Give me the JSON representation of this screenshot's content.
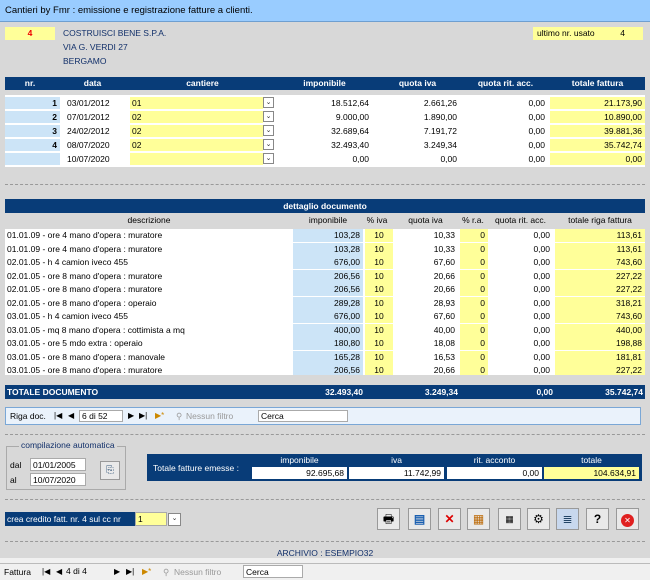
{
  "window": {
    "title": "Cantieri by Fmr : emissione e registrazione fatture a clienti."
  },
  "client": {
    "code": "4",
    "name": "COSTRUISCI BENE S.P.A.",
    "address": "VIA G. VERDI 27",
    "city": "BERGAMO"
  },
  "last_number": {
    "label": "ultimo nr. usato",
    "value": "4"
  },
  "invoices": {
    "headers": {
      "nr": "nr.",
      "data": "data",
      "cantiere": "cantiere",
      "imponibile": "imponibile",
      "iva": "quota iva",
      "rit": "quota rit. acc.",
      "totale": "totale fattura"
    },
    "rows": [
      {
        "nr": "1",
        "data": "03/01/2012",
        "cantiere": "01",
        "imponibile": "18.512,64",
        "iva": "2.661,26",
        "rit": "0,00",
        "totale": "21.173,90"
      },
      {
        "nr": "2",
        "data": "07/01/2012",
        "cantiere": "02",
        "imponibile": "9.000,00",
        "iva": "1.890,00",
        "rit": "0,00",
        "totale": "10.890,00"
      },
      {
        "nr": "3",
        "data": "24/02/2012",
        "cantiere": "02",
        "imponibile": "32.689,64",
        "iva": "7.191,72",
        "rit": "0,00",
        "totale": "39.881,36"
      },
      {
        "nr": "4",
        "data": "08/07/2020",
        "cantiere": "02",
        "imponibile": "32.493,40",
        "iva": "3.249,34",
        "rit": "0,00",
        "totale": "35.742,74"
      },
      {
        "nr": "",
        "data": "10/07/2020",
        "cantiere": "",
        "imponibile": "0,00",
        "iva": "0,00",
        "rit": "0,00",
        "totale": "0,00"
      }
    ]
  },
  "detail": {
    "title": "dettaglio documento",
    "headers": {
      "descr": "descrizione",
      "imponibile": "imponibile",
      "piva": "% iva",
      "iva": "quota iva",
      "pra": "% r.a.",
      "rit": "quota rit. acc.",
      "totale": "totale riga fattura"
    },
    "rows": [
      {
        "descr": "01.01.09 - ore 4 mano d'opera : muratore",
        "imponibile": "103,28",
        "piva": "10",
        "iva": "10,33",
        "pra": "0",
        "rit": "0,00",
        "totale": "113,61"
      },
      {
        "descr": "01.01.09 - ore 4 mano d'opera : muratore",
        "imponibile": "103,28",
        "piva": "10",
        "iva": "10,33",
        "pra": "0",
        "rit": "0,00",
        "totale": "113,61"
      },
      {
        "descr": "02.01.05 - h 4 camion iveco 455",
        "imponibile": "676,00",
        "piva": "10",
        "iva": "67,60",
        "pra": "0",
        "rit": "0,00",
        "totale": "743,60"
      },
      {
        "descr": "02.01.05 - ore 8 mano d'opera : muratore",
        "imponibile": "206,56",
        "piva": "10",
        "iva": "20,66",
        "pra": "0",
        "rit": "0,00",
        "totale": "227,22"
      },
      {
        "descr": "02.01.05 - ore 8 mano d'opera : muratore",
        "imponibile": "206,56",
        "piva": "10",
        "iva": "20,66",
        "pra": "0",
        "rit": "0,00",
        "totale": "227,22"
      },
      {
        "descr": "02.01.05 - ore 8 mano d'opera : operaio",
        "imponibile": "289,28",
        "piva": "10",
        "iva": "28,93",
        "pra": "0",
        "rit": "0,00",
        "totale": "318,21"
      },
      {
        "descr": "03.01.05 - h 4 camion iveco 455",
        "imponibile": "676,00",
        "piva": "10",
        "iva": "67,60",
        "pra": "0",
        "rit": "0,00",
        "totale": "743,60"
      },
      {
        "descr": "03.01.05 - mq 8 mano d'opera : cottimista a mq",
        "imponibile": "400,00",
        "piva": "10",
        "iva": "40,00",
        "pra": "0",
        "rit": "0,00",
        "totale": "440,00"
      },
      {
        "descr": "03.01.05 - ore 5 mdo extra : operaio",
        "imponibile": "180,80",
        "piva": "10",
        "iva": "18,08",
        "pra": "0",
        "rit": "0,00",
        "totale": "198,88"
      },
      {
        "descr": "03.01.05 - ore 8 mano d'opera : manovale",
        "imponibile": "165,28",
        "piva": "10",
        "iva": "16,53",
        "pra": "0",
        "rit": "0,00",
        "totale": "181,81"
      },
      {
        "descr": "03.01.05 - ore 8 mano d'opera : muratore",
        "imponibile": "206,56",
        "piva": "10",
        "iva": "20,66",
        "pra": "0",
        "rit": "0,00",
        "totale": "227,22"
      }
    ],
    "total": {
      "label": "TOTALE DOCUMENTO",
      "imponibile": "32.493,40",
      "iva": "3.249,34",
      "rit": "0,00",
      "totale": "35.742,74"
    },
    "nav": {
      "label": "Riga doc.",
      "position": "6 di 52",
      "filter": "Nessun filtro",
      "search": "Cerca"
    }
  },
  "auto": {
    "title": "compilazione automatica",
    "dal_label": "dal",
    "dal": "01/01/2005",
    "al_label": "al",
    "al": "10/07/2020"
  },
  "summary": {
    "label": "Totale fatture emesse :",
    "headers": {
      "imponibile": "imponibile",
      "iva": "iva",
      "rit": "rit. acconto",
      "totale": "totale"
    },
    "imponibile": "92.695,68",
    "iva": "11.742,99",
    "rit": "0,00",
    "totale": "104.634,91"
  },
  "credit": {
    "label": "crea credito fatt. nr. 4 sul cc nr",
    "value": "1"
  },
  "archive": {
    "label": "ARCHIVIO : ESEMPIO32"
  },
  "record_nav": {
    "label": "Fattura",
    "position": "4 di 4",
    "filter": "Nessun filtro",
    "search": "Cerca"
  },
  "colors": {
    "title_bar": "#99ccff",
    "navy": "#083c78",
    "yellow": "#ffff99",
    "light_blue": "#cce4f7",
    "red": "#ff0000"
  },
  "toolbar_icons": [
    "printer-icon",
    "preview-icon",
    "delete-icon",
    "export-icon",
    "calendar-icon",
    "settings-icon",
    "list-icon",
    "help-icon",
    "close-icon"
  ]
}
